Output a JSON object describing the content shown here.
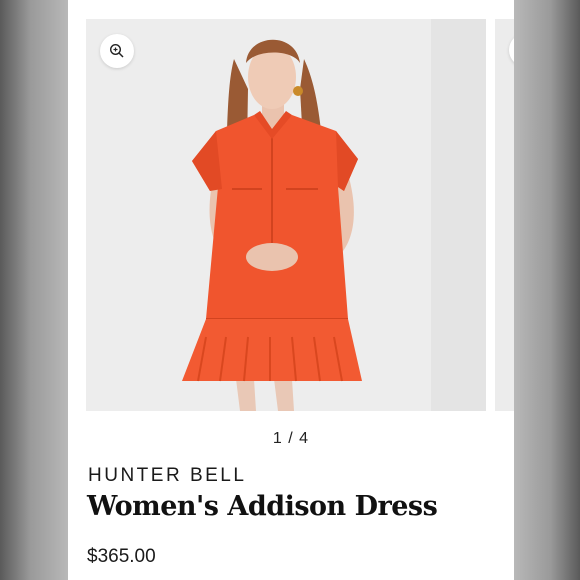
{
  "colors": {
    "background": "#ffffff",
    "gallery_bg": "#ededed",
    "dress": "#f0552e",
    "text": "#1a1a1a"
  },
  "gallery": {
    "zoom_icon": "zoom-in-icon",
    "image_alt": "Model wearing orange short-sleeve shirt dress with ruffle hem",
    "pager_text": "1 / 4"
  },
  "product": {
    "brand": "HUNTER BELL",
    "name": "Women's Addison Dress",
    "price": "$365.00"
  }
}
